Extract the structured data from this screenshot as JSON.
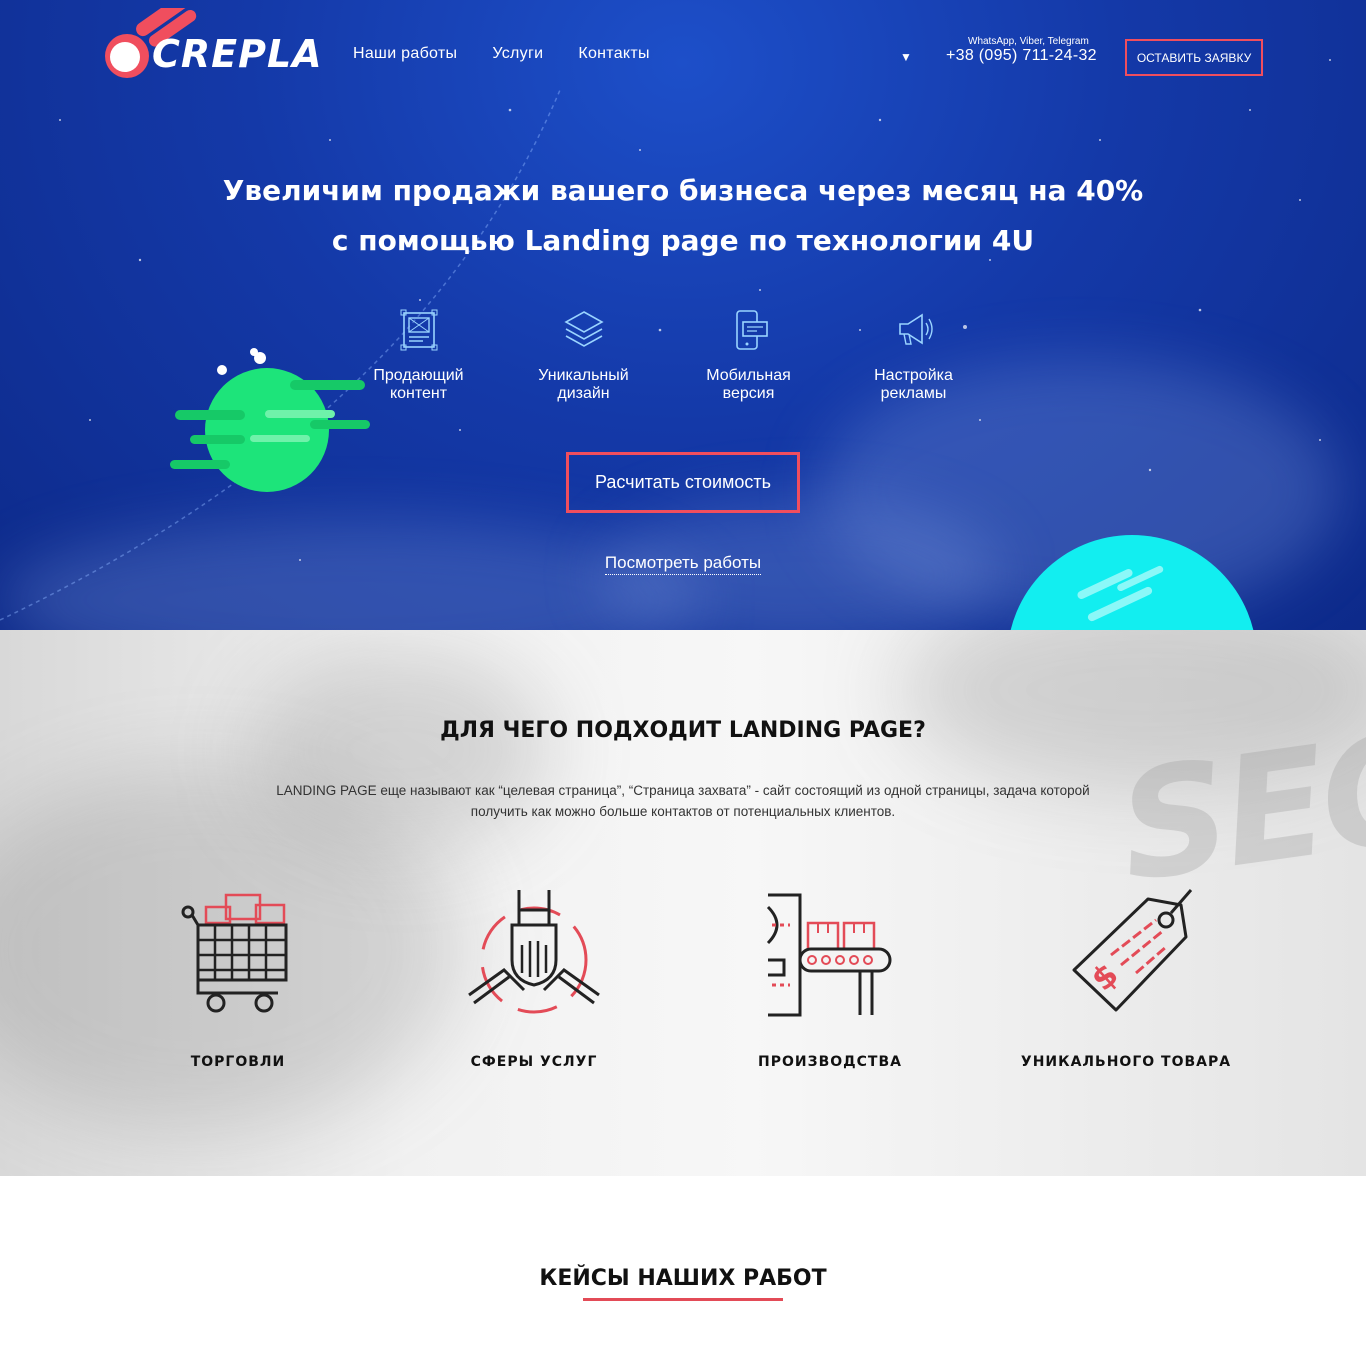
{
  "header": {
    "logo_text": "CREPLA",
    "nav": [
      {
        "label": "Наши работы"
      },
      {
        "label": "Услуги"
      },
      {
        "label": "Контакты"
      }
    ],
    "lang_arrow": "▼",
    "messengers_label": "WhatsApp, Viber, Telegram",
    "phone": "+38 (095) 711-24-32",
    "request_button": "ОСТАВИТЬ ЗАЯВКУ"
  },
  "hero": {
    "title_line1": "Увеличим продажи вашего бизнеса через месяц на 40%",
    "title_line2": "с помощью Landing page по технологии 4U",
    "features": [
      {
        "line1": "Продающий",
        "line2": "контент",
        "icon": "content-icon"
      },
      {
        "line1": "Уникальный",
        "line2": "дизайн",
        "icon": "layers-icon"
      },
      {
        "line1": "Мобильная",
        "line2": "версия",
        "icon": "mobile-icon"
      },
      {
        "line1": "Настройка",
        "line2": "рекламы",
        "icon": "megaphone-icon"
      }
    ],
    "calc_button": "Расчитать стоимость",
    "works_link": "Посмотреть работы"
  },
  "purpose": {
    "title": "ДЛЯ ЧЕГО ПОДХОДИТ LANDING PAGE?",
    "desc_line1": "LANDING PAGE еще называют как “целевая страница”, “Страница захвата” - сайт состоящий из одной страницы, задача которой",
    "desc_line2": "получить как можно больше контактов от потенциальных клиентов.",
    "categories": [
      {
        "label": "ТОРГОВЛИ",
        "icon": "shopping-cart-icon"
      },
      {
        "label": "СФЕРЫ УСЛУГ",
        "icon": "handshake-icon"
      },
      {
        "label": "ПРОИЗВОДСТВА",
        "icon": "conveyor-icon"
      },
      {
        "label": "УНИКАЛЬНОГО ТОВАРА",
        "icon": "price-tag-icon"
      }
    ]
  },
  "cases": {
    "title": "КЕЙСЫ НАШИХ РАБОТ"
  },
  "colors": {
    "accent": "#f04e5e",
    "hero_bg": "#1439a8",
    "planet_green": "#1de47a",
    "planet_cyan": "#12eef0"
  }
}
